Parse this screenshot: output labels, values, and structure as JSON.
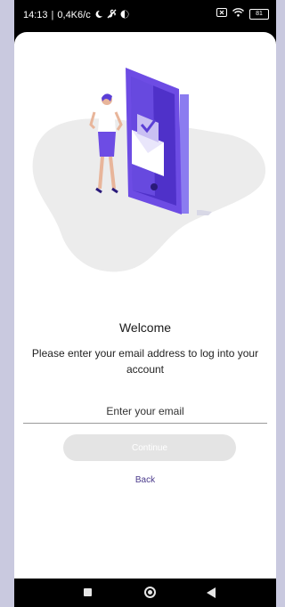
{
  "status_bar": {
    "time": "14:13",
    "speed": "0,4K6/c",
    "battery": "81"
  },
  "login": {
    "welcome": "Welcome",
    "subtitle": "Please enter your email address to log into your account",
    "email_placeholder": "Enter your email",
    "continue_label": "Continue",
    "back_label": "Back"
  },
  "colors": {
    "accent": "#5b3fd6",
    "link": "#4b3b8c",
    "button_disabled": "#e4e4e4"
  },
  "icons": {
    "status": [
      "moon-icon",
      "fan-icon",
      "data-icon",
      "sim-x-icon",
      "wifi-icon",
      "battery-icon"
    ],
    "nav": [
      "recent-apps-icon",
      "home-icon",
      "back-icon"
    ]
  }
}
